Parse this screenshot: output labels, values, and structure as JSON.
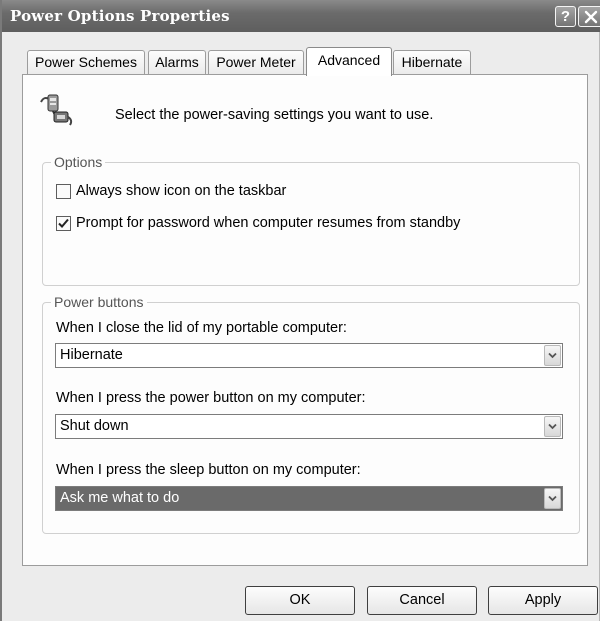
{
  "window": {
    "title": "Power Options Properties"
  },
  "titlebar_buttons": {
    "help": "?"
  },
  "tabs": [
    {
      "label": "Power Schemes"
    },
    {
      "label": "Alarms"
    },
    {
      "label": "Power Meter"
    },
    {
      "label": "Advanced",
      "active": true
    },
    {
      "label": "Hibernate"
    }
  ],
  "header": {
    "text": "Select the power-saving settings you want to use.",
    "icon": "power-settings-icon"
  },
  "options": {
    "legend": "Options",
    "always_show_icon": {
      "label": "Always show icon on the taskbar",
      "checked": false
    },
    "prompt_password": {
      "label": "Prompt for password when computer resumes from standby",
      "checked": true
    }
  },
  "power_buttons": {
    "legend": "Power buttons",
    "lid": {
      "label": "When I close the lid of my portable computer:",
      "value": "Hibernate"
    },
    "power": {
      "label": "When I press the power button on my computer:",
      "value": "Shut down"
    },
    "sleep": {
      "label": "When I press the sleep button on my computer:",
      "value": "Ask me what to do"
    }
  },
  "buttons": {
    "ok": "OK",
    "cancel": "Cancel",
    "apply": "Apply"
  },
  "colors": {
    "titlebar": "#6b6b6b",
    "selection": "#6a6a6a",
    "panel": "#fdfdfd"
  }
}
